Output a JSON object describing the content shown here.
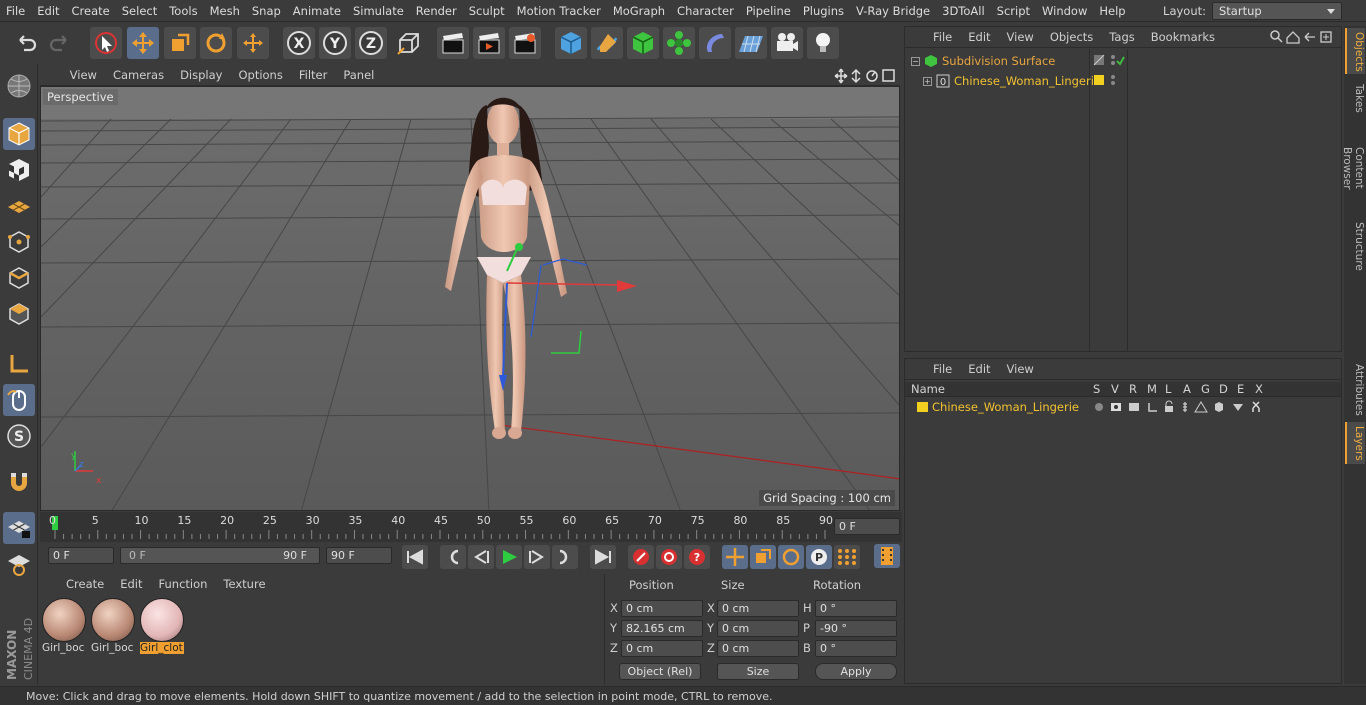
{
  "menubar": {
    "items": [
      "File",
      "Edit",
      "Create",
      "Select",
      "Tools",
      "Mesh",
      "Snap",
      "Animate",
      "Simulate",
      "Render",
      "Sculpt",
      "Motion Tracker",
      "MoGraph",
      "Character",
      "Pipeline",
      "Plugins",
      "V-Ray Bridge",
      "3DToAll",
      "Script",
      "Window",
      "Help"
    ],
    "layout_label": "Layout:",
    "layout_value": "Startup"
  },
  "viewport": {
    "menu": [
      "View",
      "Cameras",
      "Display",
      "Options",
      "Filter",
      "Panel"
    ],
    "label": "Perspective",
    "grid_spacing": "Grid Spacing : 100 cm"
  },
  "timeline": {
    "ticks": [
      "0",
      "5",
      "10",
      "15",
      "20",
      "25",
      "30",
      "35",
      "40",
      "45",
      "50",
      "55",
      "60",
      "65",
      "70",
      "75",
      "80",
      "85",
      "90"
    ],
    "current_frame": "0 F"
  },
  "controls": {
    "start_field": "0 F",
    "range_start": "0 F",
    "range_end": "90 F",
    "end_field": "90 F"
  },
  "materials": {
    "menu": [
      "Create",
      "Edit",
      "Function",
      "Texture"
    ],
    "items": [
      {
        "label": "Girl_boc",
        "selected": false
      },
      {
        "label": "Girl_boc",
        "selected": false
      },
      {
        "label": "Girl_clot",
        "selected": true
      }
    ]
  },
  "attributes": {
    "headers": [
      "Position",
      "Size",
      "Rotation"
    ],
    "rows": [
      {
        "pos_label": "X",
        "pos": "0 cm",
        "size_label": "X",
        "size": "0 cm",
        "rot_label": "H",
        "rot": "0 °"
      },
      {
        "pos_label": "Y",
        "pos": "82.165 cm",
        "size_label": "Y",
        "size": "0 cm",
        "rot_label": "P",
        "rot": "-90 °"
      },
      {
        "pos_label": "Z",
        "pos": "0 cm",
        "size_label": "Z",
        "size": "0 cm",
        "rot_label": "B",
        "rot": "0 °"
      }
    ],
    "coord_mode": "Object (Rel)",
    "size_mode": "Size",
    "apply": "Apply"
  },
  "objects": {
    "menu": [
      "File",
      "Edit",
      "View",
      "Objects",
      "Tags",
      "Bookmarks"
    ],
    "items": [
      "Subdivision Surface",
      "Chinese_Woman_Lingerie"
    ]
  },
  "layers": {
    "menu": [
      "File",
      "Edit",
      "View"
    ],
    "columns": [
      "Name",
      "S",
      "V",
      "R",
      "M",
      "L",
      "A",
      "G",
      "D",
      "E",
      "X"
    ],
    "items": [
      "Chinese_Woman_Lingerie"
    ]
  },
  "right_tabs": [
    "Objects",
    "Takes",
    "Content Browser",
    "Structure",
    "Attributes",
    "Layers"
  ],
  "status": "Move: Click and drag to move elements. Hold down SHIFT to quantize movement / add to the selection in point mode, CTRL to remove.",
  "brand": {
    "line1": "MAXON",
    "line2": "CINEMA 4D"
  },
  "colors": {
    "accent": "#f0a030",
    "selection": "#5a6e8c",
    "layer_yellow": "#f2d020"
  }
}
